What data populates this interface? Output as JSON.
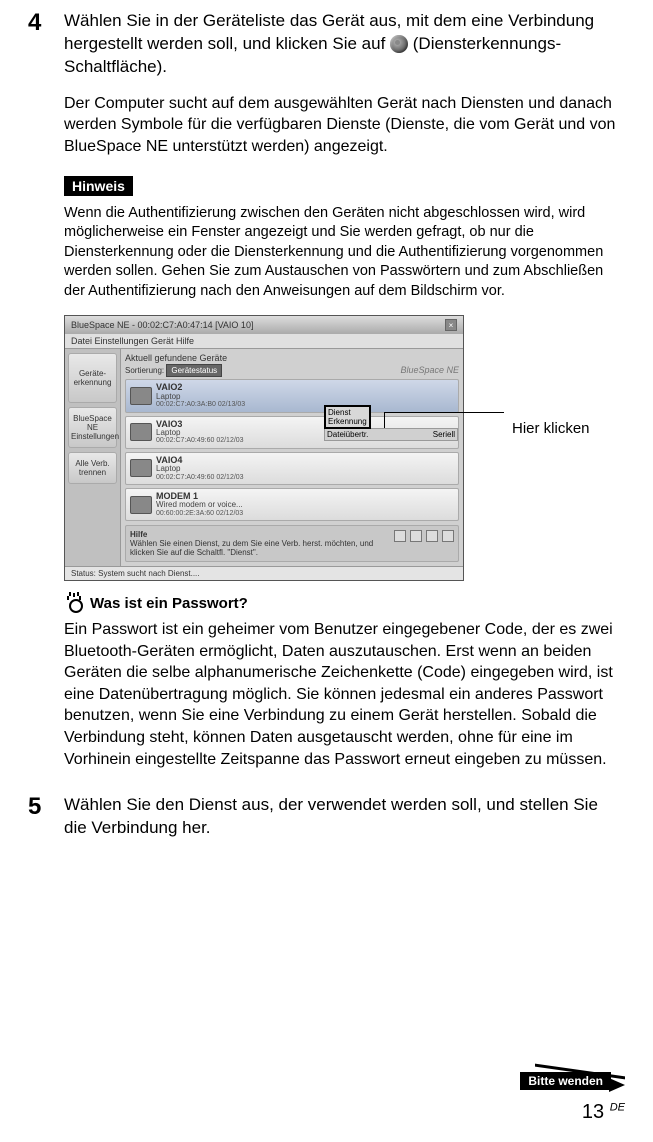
{
  "step4": {
    "num": "4",
    "head_a": "Wählen Sie in der Geräteliste das Gerät aus, mit dem eine Verbindung hergestellt werden soll, und klicken Sie auf ",
    "head_b": " (Diensterkennungs-Schaltfläche).",
    "desc": "Der Computer sucht auf dem ausgewählten Gerät nach Diensten und danach werden Symbole für die verfügbaren Dienste (Dienste, die vom Gerät und von BlueSpace NE unterstützt werden) angezeigt."
  },
  "hinweis": {
    "tag": "Hinweis",
    "text": "Wenn die Authentifizierung zwischen den Geräten nicht abgeschlossen wird, wird möglicherweise ein Fenster angezeigt und Sie werden gefragt, ob nur die Diensterkennung oder die Diensterkennung und die Authentifizierung vorgenommen werden sollen. Gehen Sie zum Austauschen von Passwörtern und zum Abschließen der Authentifizierung nach den Anweisungen auf dem Bildschirm vor."
  },
  "shot": {
    "title": "BlueSpace NE - 00:02:C7:A0:47:14 [VAIO 10]",
    "menu": "Datei  Einstellungen  Gerät  Hilfe",
    "found": "Aktuell gefundene Geräte",
    "sort_label": "Sortierung:",
    "sort_value": "Gerätestatus",
    "brand": "BlueSpace NE",
    "side": {
      "erk": "Geräte-\nerkennung",
      "einst": "BlueSpace NE\nEinstellungen",
      "trenn": "Alle Verb.\ntrennen"
    },
    "devs": [
      {
        "name": "VAIO2",
        "sub": "Laptop",
        "mac": "00:02:C7:A0:3A:B0 02/13/03"
      },
      {
        "name": "VAIO3",
        "sub": "Laptop",
        "mac": "00:02:C7:A0:49:60  02/12/03"
      },
      {
        "name": "VAIO4",
        "sub": "Laptop",
        "mac": "00:02:C7:A0:49:60  02/12/03"
      },
      {
        "name": "MODEM 1",
        "sub": "Wired modem or voice...",
        "mac": "00:60:00:2E:3A:60 02/12/03"
      }
    ],
    "serv": {
      "a": "Dienst\nErkennung",
      "b1": "Dateiübertr.",
      "b2": "Seriell"
    },
    "hilfe_title": "Hilfe",
    "hilfe_text": "Wählen Sie einen Dienst, zu dem Sie eine Verb. herst. möchten, und klicken Sie auf die Schaltfl. \"Dienst\".",
    "status": "Status: System sucht nach Dienst...."
  },
  "callout": "Hier klicken",
  "tip": {
    "title": "Was ist ein Passwort?",
    "body": "Ein Passwort ist ein geheimer vom Benutzer eingegebener Code, der es zwei Bluetooth-Geräten ermöglicht, Daten auszutauschen. Erst wenn an beiden Geräten die selbe alphanumerische Zeichenkette (Code) eingegeben wird, ist eine Datenübertragung möglich. Sie können jedesmal ein anderes Passwort benutzen, wenn Sie eine Verbindung zu einem Gerät herstellen. Sobald die Verbindung steht, können Daten ausgetauscht werden, ohne für eine im Vorhinein eingestellte Zeitspanne das Passwort erneut eingeben zu müssen."
  },
  "step5": {
    "num": "5",
    "head": "Wählen Sie den Dienst aus, der verwendet werden soll, und stellen Sie die Verbindung her."
  },
  "wenden": "Bitte wenden",
  "page": {
    "num": "13",
    "suf": "DE"
  }
}
